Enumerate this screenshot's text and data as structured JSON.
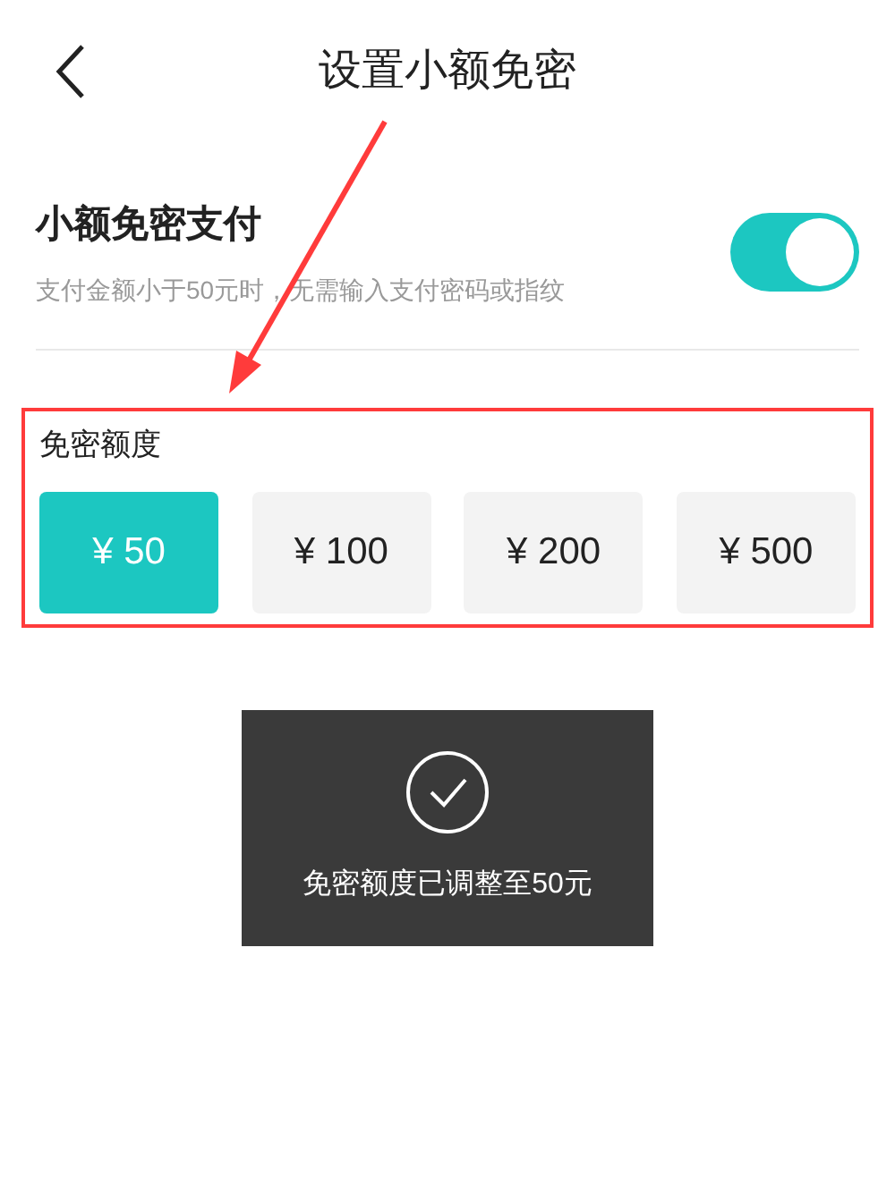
{
  "header": {
    "title": "设置小额免密"
  },
  "setting": {
    "title": "小额免密支付",
    "description": "支付金额小于50元时，无需输入支付密码或指纹",
    "on": true
  },
  "limit": {
    "label": "免密额度",
    "options": [
      {
        "label": "¥ 50",
        "selected": true
      },
      {
        "label": "¥ 100",
        "selected": false
      },
      {
        "label": "¥ 200",
        "selected": false
      },
      {
        "label": "¥ 500",
        "selected": false
      }
    ]
  },
  "toast": {
    "message": "免密额度已调整至50元"
  }
}
